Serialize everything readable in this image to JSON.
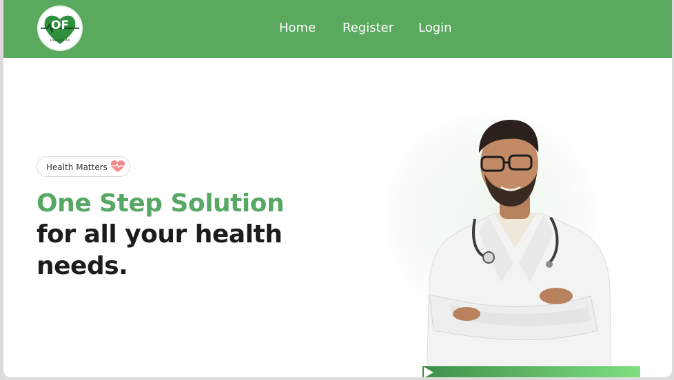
{
  "header": {
    "logo": {
      "initials": "OF",
      "tagline": "One For All",
      "icon": "heart-pulse-logo"
    },
    "nav": [
      {
        "label": "Home"
      },
      {
        "label": "Register"
      },
      {
        "label": "Login"
      }
    ],
    "background_color": "#5aa95f"
  },
  "hero": {
    "badge": {
      "label": "Health Matters",
      "icon": "heart-icon"
    },
    "headline_highlight": "One Step Solution",
    "headline_rest": "for all your health needs.",
    "accent_color": "#58a865",
    "image": "doctor-with-stethoscope"
  }
}
